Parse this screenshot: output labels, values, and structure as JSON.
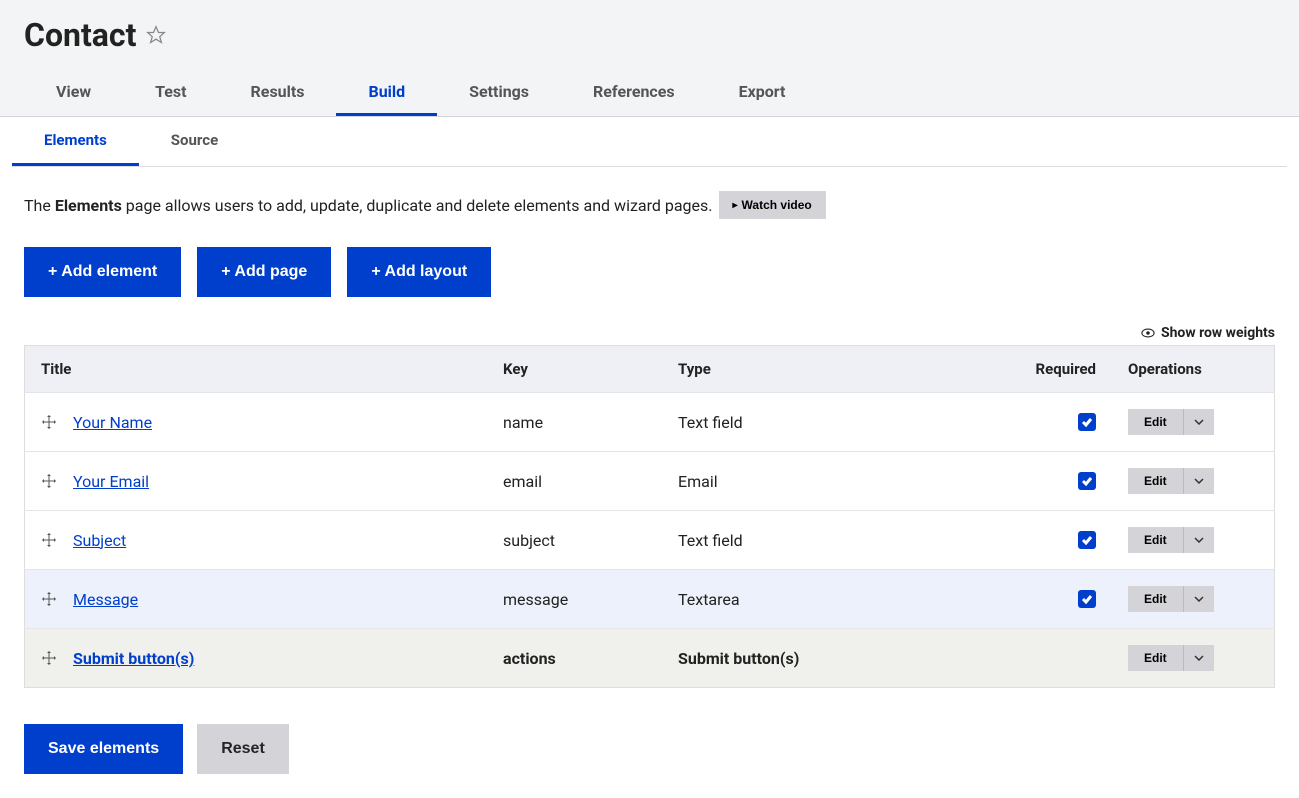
{
  "page": {
    "title": "Contact"
  },
  "primary_tabs": [
    {
      "label": "View",
      "active": false
    },
    {
      "label": "Test",
      "active": false
    },
    {
      "label": "Results",
      "active": false
    },
    {
      "label": "Build",
      "active": true
    },
    {
      "label": "Settings",
      "active": false
    },
    {
      "label": "References",
      "active": false
    },
    {
      "label": "Export",
      "active": false
    }
  ],
  "secondary_tabs": [
    {
      "label": "Elements",
      "active": true
    },
    {
      "label": "Source",
      "active": false
    }
  ],
  "description": {
    "prefix": "The ",
    "bold": "Elements",
    "suffix": " page allows users to add, update, duplicate and delete elements and wizard pages.",
    "watch_video": "Watch video"
  },
  "action_buttons": {
    "add_element": "+ Add element",
    "add_page": "+ Add page",
    "add_layout": "+ Add layout"
  },
  "show_row_weights": "Show row weights",
  "table": {
    "headers": {
      "title": "Title",
      "key": "Key",
      "type": "Type",
      "required": "Required",
      "operations": "Operations"
    },
    "rows": [
      {
        "title": "Your Name",
        "key": "name",
        "type": "Text field",
        "required": true,
        "highlight": false,
        "footer": false
      },
      {
        "title": "Your Email",
        "key": "email",
        "type": "Email",
        "required": true,
        "highlight": false,
        "footer": false
      },
      {
        "title": "Subject",
        "key": "subject",
        "type": "Text field",
        "required": true,
        "highlight": false,
        "footer": false
      },
      {
        "title": "Message",
        "key": "message",
        "type": "Textarea",
        "required": true,
        "highlight": true,
        "footer": false
      },
      {
        "title": "Submit button(s)",
        "key": "actions",
        "type": "Submit button(s)",
        "required": null,
        "highlight": false,
        "footer": true
      }
    ],
    "edit_label": "Edit"
  },
  "bottom": {
    "save": "Save elements",
    "reset": "Reset"
  }
}
